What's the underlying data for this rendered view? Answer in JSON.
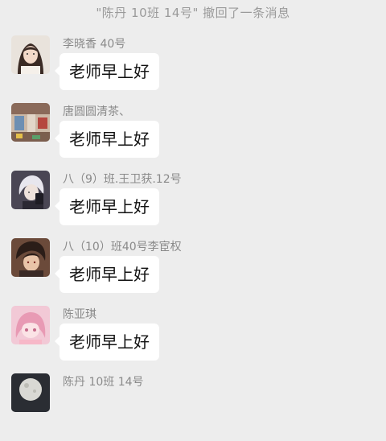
{
  "chat": {
    "recall_notice": "\"陈丹 10班 14号\" 撤回了一条消息",
    "messages": [
      {
        "sender": "李晓香   40号",
        "text": "老师早上好",
        "avatar_icon": "girl-portrait-avatar"
      },
      {
        "sender": "唐圆圆清茶、",
        "text": "老师早上好",
        "avatar_icon": "room-photo-avatar"
      },
      {
        "sender": "八（9）班.王卫获.12号",
        "text": "老师早上好",
        "avatar_icon": "white-hair-character-avatar"
      },
      {
        "sender": "八（10）班40号李宦权",
        "text": "老师早上好",
        "avatar_icon": "anime-boy-avatar"
      },
      {
        "sender": "陈亚琪",
        "text": "老师早上好",
        "avatar_icon": "pink-anime-girl-avatar"
      },
      {
        "sender": "陈丹 10班 14号",
        "text": "",
        "avatar_icon": "moon-avatar"
      }
    ]
  },
  "colors": {
    "background": "#ededed",
    "bubble": "#ffffff",
    "sender_text": "#8a8a8a",
    "notice_text": "#9a9a9a"
  }
}
